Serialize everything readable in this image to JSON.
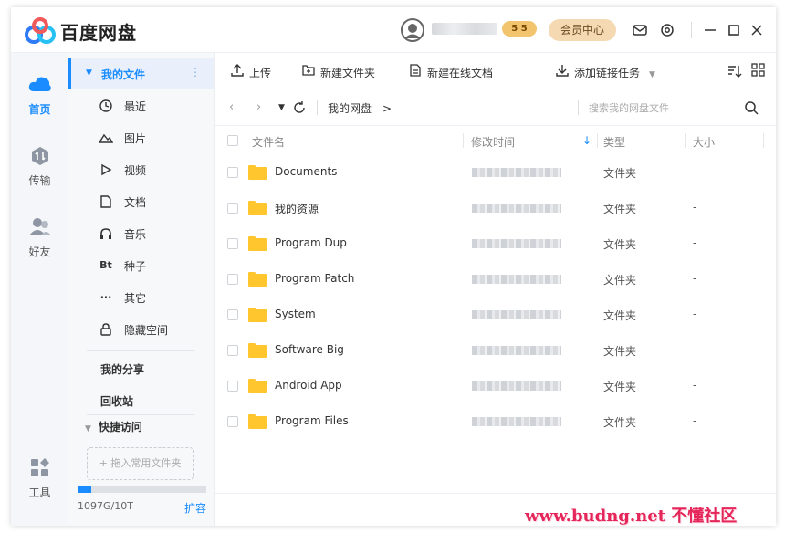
{
  "app": {
    "name": "百度网盘",
    "vip_level": "5 5",
    "member_center": "会员中心"
  },
  "leftnav": {
    "items": [
      {
        "label": "首页",
        "icon": "home-cloud-icon",
        "active": true
      },
      {
        "label": "传输",
        "icon": "transfer-icon",
        "active": false
      },
      {
        "label": "好友",
        "icon": "friends-icon",
        "active": false
      },
      {
        "label": "工具",
        "icon": "tools-grid-icon",
        "active": false
      }
    ]
  },
  "sidebar": {
    "header": "我的文件",
    "categories": [
      {
        "label": "最近",
        "icon": "clock-icon"
      },
      {
        "label": "图片",
        "icon": "mountain-image-icon"
      },
      {
        "label": "视频",
        "icon": "play-icon"
      },
      {
        "label": "文档",
        "icon": "document-icon"
      },
      {
        "label": "音乐",
        "icon": "headphones-icon"
      },
      {
        "label": "种子",
        "icon": "bt-icon",
        "glyph": "Bt"
      },
      {
        "label": "其它",
        "icon": "more-dots-icon",
        "glyph": "···"
      },
      {
        "label": "隐藏空间",
        "icon": "lock-icon"
      }
    ],
    "my_share": "我的分享",
    "recycle_bin": "回收站",
    "quick_access": "快捷访问",
    "drop_hint": "+ 拖入常用文件夹",
    "storage": {
      "used_text": "1097G/10T",
      "fill_fraction": 0.107,
      "expand": "扩容"
    }
  },
  "toolbar": {
    "upload": "上传",
    "new_folder": "新建文件夹",
    "new_online_doc": "新建在线文档",
    "add_link_task": "添加链接任务"
  },
  "addressbar": {
    "breadcrumb": "我的网盘",
    "search_placeholder": "搜索我的网盘文件"
  },
  "table": {
    "columns": {
      "name": "文件名",
      "modified": "修改时间",
      "type": "类型",
      "size": "大小"
    },
    "rows": [
      {
        "name": "Documents",
        "type": "文件夹",
        "size": "-"
      },
      {
        "name": "我的资源",
        "type": "文件夹",
        "size": "-"
      },
      {
        "name": "Program Dup",
        "type": "文件夹",
        "size": "-"
      },
      {
        "name": "Program Patch",
        "type": "文件夹",
        "size": "-"
      },
      {
        "name": "System",
        "type": "文件夹",
        "size": "-"
      },
      {
        "name": "Software Big",
        "type": "文件夹",
        "size": "-"
      },
      {
        "name": "Android App",
        "type": "文件夹",
        "size": "-"
      },
      {
        "name": "Program Files",
        "type": "文件夹",
        "size": "-"
      }
    ]
  },
  "watermark": "www.budng.net 不懂社区",
  "colors": {
    "accent": "#1a8cff",
    "folder": "#ffc62e",
    "member": "#f5d9b3"
  }
}
